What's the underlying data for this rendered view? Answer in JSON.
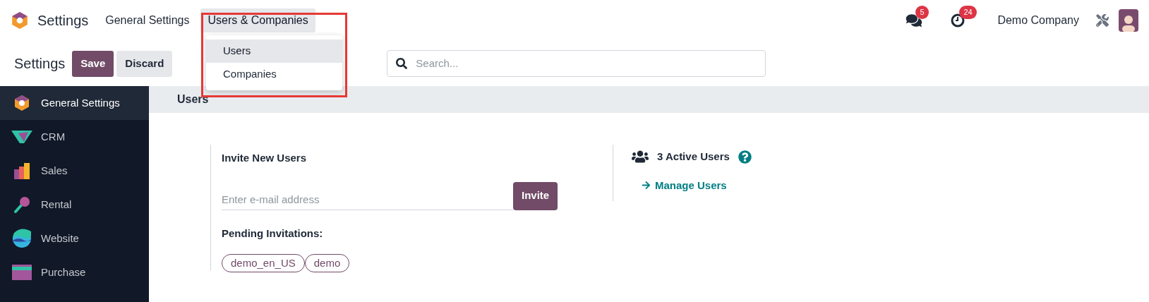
{
  "navbar": {
    "app_name": "Settings",
    "menus": [
      {
        "label": "General Settings",
        "selected": false
      },
      {
        "label": "Users & Companies",
        "selected": true
      }
    ],
    "dropdown": {
      "items": [
        {
          "label": "Users",
          "selected": true
        },
        {
          "label": "Companies",
          "selected": false
        }
      ]
    },
    "messages_badge": "5",
    "activities_badge": "24",
    "company": "Demo Company"
  },
  "control_panel": {
    "title": "Settings",
    "buttons": [
      "Save",
      "Discard"
    ],
    "search": {
      "placeholder": "Search..."
    }
  },
  "sidebar": {
    "items": [
      {
        "label": "General Settings",
        "kind": "general",
        "selected": true
      },
      {
        "label": "CRM",
        "kind": "crm",
        "selected": false
      },
      {
        "label": "Sales",
        "kind": "sales",
        "selected": false
      },
      {
        "label": "Rental",
        "kind": "rental",
        "selected": false
      },
      {
        "label": "Website",
        "kind": "website",
        "selected": false
      },
      {
        "label": "Purchase",
        "kind": "purchase",
        "selected": false
      }
    ]
  },
  "section": {
    "title": "Users",
    "invite": {
      "title": "Invite New Users",
      "placeholder": "Enter e-mail address",
      "button": "Invite",
      "pending_label": "Pending Invitations:",
      "pending": [
        "demo_en_US",
        "demo"
      ]
    },
    "active": {
      "count_text": "3 Active Users",
      "link": "Manage Users"
    }
  }
}
